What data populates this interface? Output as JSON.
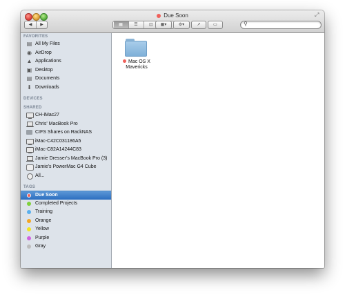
{
  "window": {
    "title": "Due Soon",
    "title_tag_color": "#f0605a"
  },
  "toolbar": {
    "back_icon": "chevron-left-icon",
    "forward_icon": "chevron-right-icon",
    "view_modes": [
      "icon-view",
      "list-view",
      "column-view",
      "cover-flow-view"
    ],
    "active_view": "icon-view",
    "search": {
      "placeholder": "",
      "value": ""
    }
  },
  "sidebar": {
    "favorites_header": "FAVORITES",
    "favorites": [
      {
        "label": "All My Files",
        "icon": "all-my-files-icon"
      },
      {
        "label": "AirDrop",
        "icon": "airdrop-icon"
      },
      {
        "label": "Applications",
        "icon": "applications-icon"
      },
      {
        "label": "Desktop",
        "icon": "desktop-icon"
      },
      {
        "label": "Documents",
        "icon": "documents-icon"
      },
      {
        "label": "Downloads",
        "icon": "downloads-icon"
      }
    ],
    "devices_header": "DEVICES",
    "shared_header": "SHARED",
    "shared": [
      {
        "label": "CH-iMac27",
        "icon": "imac-icon"
      },
      {
        "label": "Chris' MacBook Pro",
        "icon": "laptop-icon"
      },
      {
        "label": "CIFS Shares on RackNAS",
        "icon": "nas-icon"
      },
      {
        "label": "iMac-C42C031186A5",
        "icon": "imac-icon"
      },
      {
        "label": "iMac-C82A14244C83",
        "icon": "imac-icon"
      },
      {
        "label": "Jamie Dresser's MacBook Pro (3)",
        "icon": "laptop-icon"
      },
      {
        "label": "Jamie's PowerMac G4 Cube",
        "icon": "cube-icon"
      },
      {
        "label": "All...",
        "icon": "network-icon"
      }
    ],
    "tags_header": "TAGS",
    "tags": [
      {
        "label": "Due Soon",
        "color": "#f0605a",
        "selected": true
      },
      {
        "label": "Completed Projects",
        "color": "#7fd13b",
        "selected": false
      },
      {
        "label": "Training",
        "color": "#5ab0ee",
        "selected": false
      },
      {
        "label": "Orange",
        "color": "#f5a623",
        "selected": false
      },
      {
        "label": "Yellow",
        "color": "#f2e421",
        "selected": false
      },
      {
        "label": "Purple",
        "color": "#d063e0",
        "selected": false
      },
      {
        "label": "Gray",
        "color": "#bdbdbd",
        "selected": false
      }
    ]
  },
  "content": {
    "items": [
      {
        "name": "Mac OS X Mavericks",
        "tag_color": "#f0605a",
        "icon": "folder-icon"
      }
    ]
  }
}
